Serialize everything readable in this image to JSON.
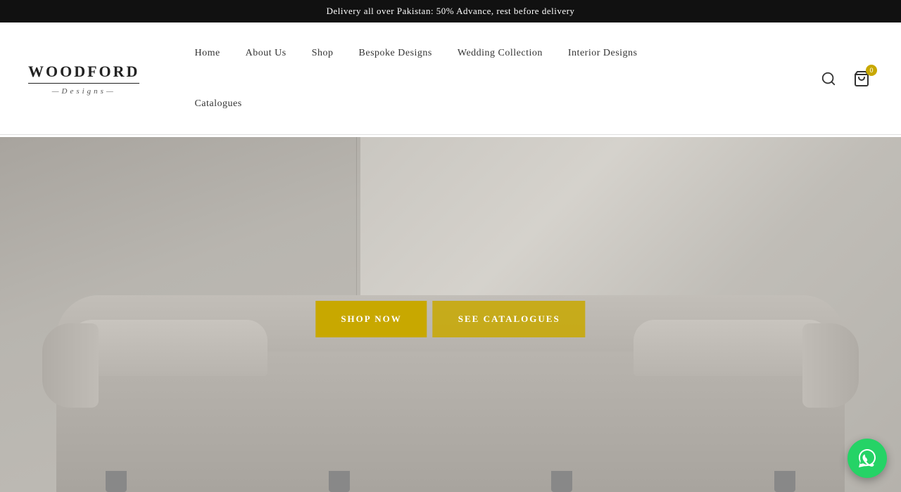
{
  "announcement": {
    "text": "Delivery all over Pakistan: 50% Advance, rest before delivery"
  },
  "header": {
    "logo": {
      "brand": "WOODFORD",
      "sub": "—Designs—"
    },
    "nav_top": [
      {
        "label": "Home",
        "id": "home"
      },
      {
        "label": "About Us",
        "id": "about"
      },
      {
        "label": "Shop",
        "id": "shop"
      },
      {
        "label": "Bespoke Designs",
        "id": "bespoke"
      },
      {
        "label": "Wedding Collection",
        "id": "wedding"
      },
      {
        "label": "Interior Designs",
        "id": "interior"
      }
    ],
    "nav_bottom": [
      {
        "label": "Catalogues",
        "id": "catalogues"
      }
    ],
    "cart_count": "0"
  },
  "hero": {
    "cta_primary": "SHOP NOW",
    "cta_secondary": "SEE CATALOGUES"
  },
  "whatsapp": {
    "aria": "WhatsApp Contact"
  }
}
